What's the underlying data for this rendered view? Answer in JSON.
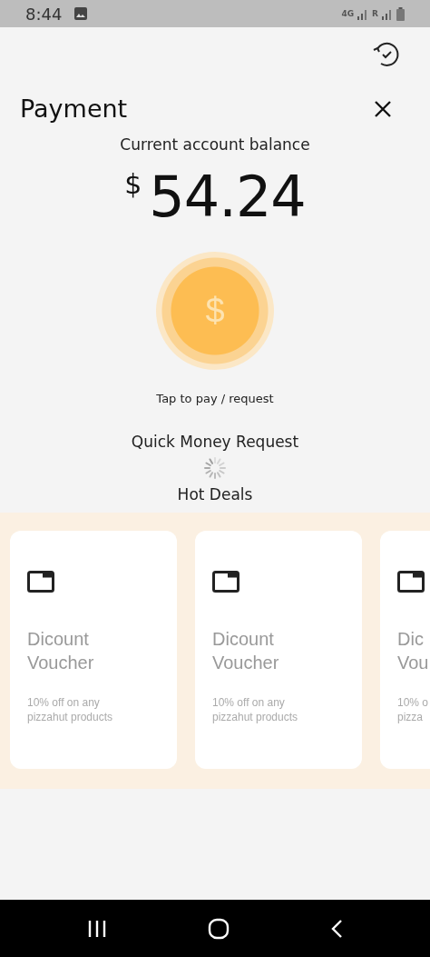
{
  "status_bar": {
    "time": "8:44",
    "network": "4G",
    "roaming": "R"
  },
  "header": {
    "title": "Payment"
  },
  "balance": {
    "label": "Current account balance",
    "currency": "$",
    "amount": "54.24"
  },
  "pay_button": {
    "symbol": "$",
    "caption": "Tap to pay / request"
  },
  "quick_request": {
    "title": "Quick Money Request"
  },
  "hot_deals": {
    "title": "Hot Deals",
    "cards": [
      {
        "title_lines": [
          "Dicount",
          "Voucher"
        ],
        "description_lines": [
          "10% off on any",
          "pizzahut products"
        ]
      },
      {
        "title_lines": [
          "Dicount",
          "Voucher"
        ],
        "description_lines": [
          "10% off on any",
          "pizzahut products"
        ]
      },
      {
        "title_lines": [
          "Dic",
          "Vou"
        ],
        "description_lines": [
          "10% o",
          "pizza"
        ]
      }
    ]
  }
}
